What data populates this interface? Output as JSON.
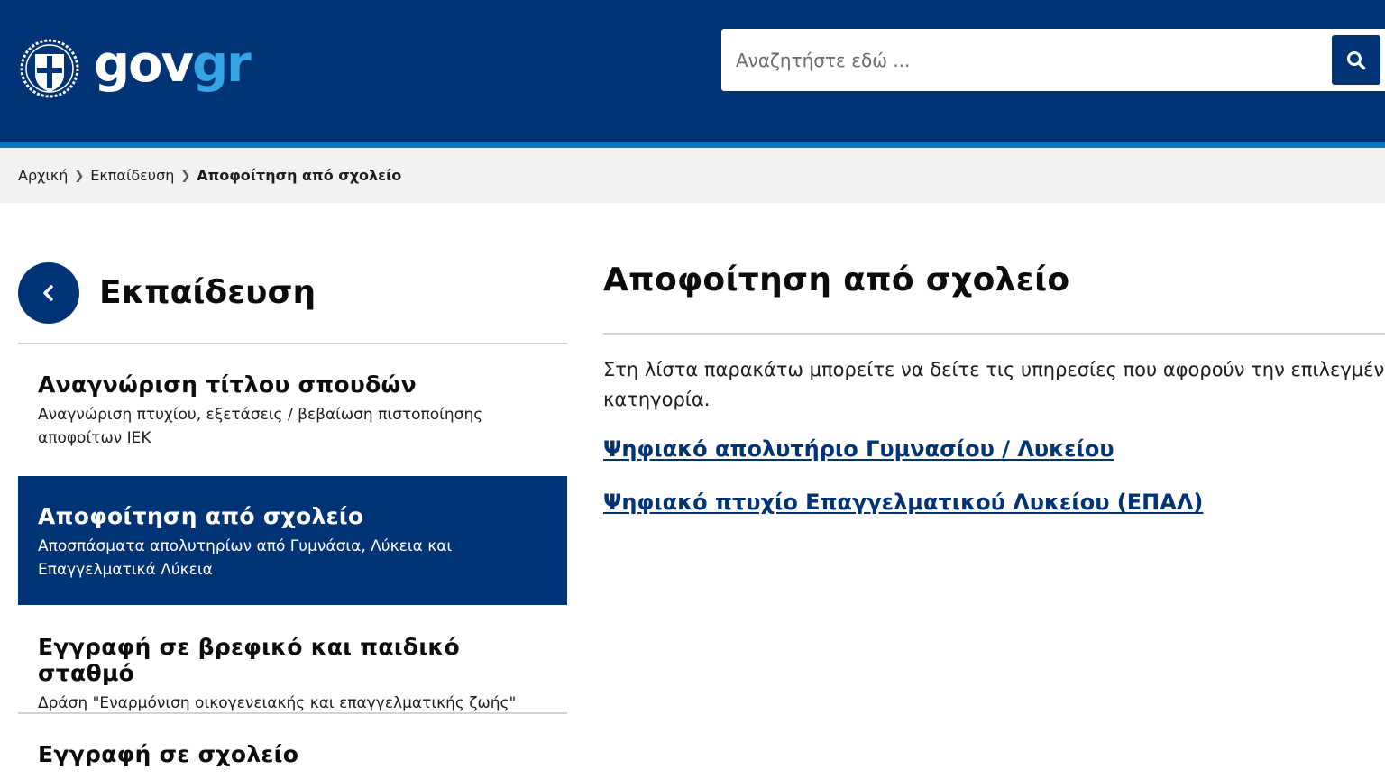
{
  "header": {
    "logo": {
      "gov": "gov",
      "gr": "gr"
    },
    "search": {
      "placeholder": "Αναζητήστε εδώ ...",
      "button_icon": "search-icon"
    },
    "colors": {
      "primary": "#003476",
      "accent": "#34a6e8",
      "stripe": "#0a77c2"
    }
  },
  "breadcrumb": {
    "items": [
      "Αρχική",
      "Εκπαίδευση"
    ],
    "current": "Αποφοίτηση από σχολείο"
  },
  "sidebar": {
    "back_icon": "chevron-left-icon",
    "title": "Εκπαίδευση",
    "items": [
      {
        "title": "Αναγνώριση τίτλου σπουδών",
        "description": "Αναγνώριση πτυχίου, εξετάσεις / βεβαίωση πιστοποίησης αποφοίτων ΙΕΚ",
        "active": false
      },
      {
        "title": "Αποφοίτηση από σχολείο",
        "description": "Αποσπάσματα απολυτηρίων από Γυμνάσια, Λύκεια και Επαγγελματικά Λύκεια",
        "active": true
      },
      {
        "title": "Εγγραφή σε βρεφικό και παιδικό σταθμό",
        "description": "Δράση \"Εναρμόνιση οικογενειακής και επαγγελματικής ζωής\"",
        "active": false
      },
      {
        "title": "Εγγραφή σε σχολείο",
        "active": false
      }
    ]
  },
  "main": {
    "title": "Αποφοίτηση από σχολείο",
    "intro": "Στη λίστα παρακάτω μπορείτε να δείτε τις υπηρεσίες που αφορούν την επιλεγμένη κατηγορία.",
    "links": [
      "Ψηφιακό απολυτήριο Γυμνασίου / Λυκείου",
      "Ψηφιακό πτυχίο Επαγγελματικού Λυκείου (ΕΠΑΛ)"
    ]
  }
}
